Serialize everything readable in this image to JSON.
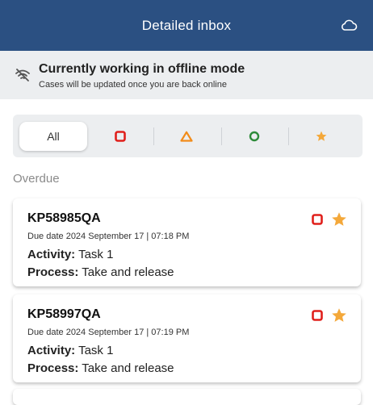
{
  "header": {
    "title": "Detailed inbox",
    "cloud_icon": "cloud-icon"
  },
  "offline": {
    "title": "Currently working in offline mode",
    "subtitle": "Cases will be updated once you are back online",
    "icon": "wifi-off-icon"
  },
  "filters": {
    "all_label": "All",
    "items": [
      {
        "icon": "red-square-icon",
        "color": "#e0201c"
      },
      {
        "icon": "orange-triangle-icon",
        "color": "#f28c1a"
      },
      {
        "icon": "green-circle-icon",
        "color": "#2e8b3a"
      },
      {
        "icon": "star-icon",
        "color": "#f4a83a"
      }
    ]
  },
  "section": {
    "label": "Overdue"
  },
  "cards": [
    {
      "id": "KP58985QA",
      "due": "Due date 2024 September 17 | 07:18 PM",
      "activity_label": "Activity:",
      "activity": "Task 1",
      "process_label": "Process:",
      "process": "Take and release"
    },
    {
      "id": "KP58997QA",
      "due": "Due date 2024 September 17 | 07:19 PM",
      "activity_label": "Activity:",
      "activity": "Task 1",
      "process_label": "Process:",
      "process": "Take and release"
    }
  ],
  "colors": {
    "header_bg": "#2b5082",
    "banner_bg": "#eceef0",
    "priority_red": "#e0201c",
    "star_orange": "#f4a83a"
  }
}
